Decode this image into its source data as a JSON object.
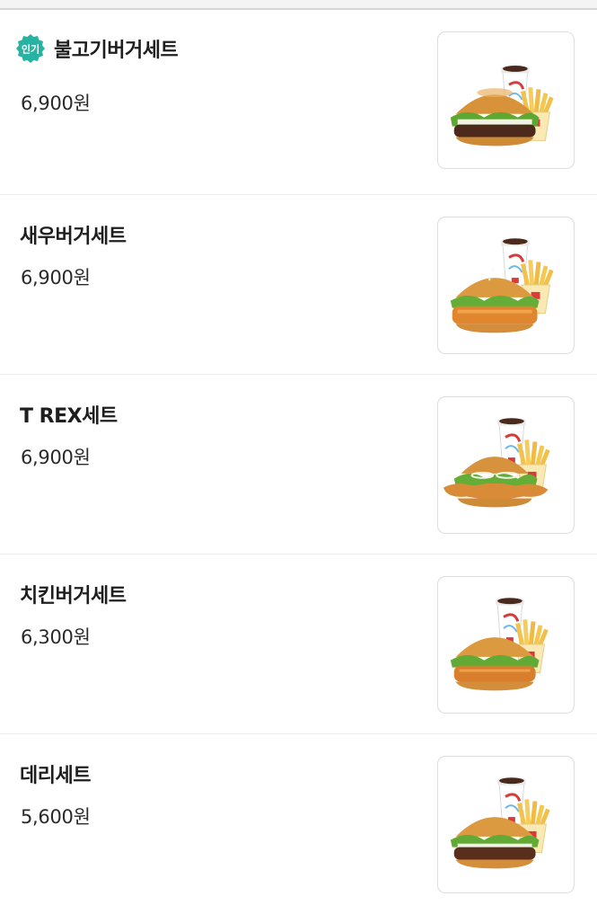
{
  "badge": {
    "label": "인기",
    "color": "#26b3a2",
    "icon": "popular-badge-icon"
  },
  "menu": [
    {
      "name": "불고기버거세트",
      "price": "6,900원",
      "popular": true,
      "image": "bulgogi-burger-set-image"
    },
    {
      "name": "새우버거세트",
      "price": "6,900원",
      "popular": false,
      "image": "shrimp-burger-set-image"
    },
    {
      "name": "T REX세트",
      "price": "6,900원",
      "popular": false,
      "image": "t-rex-set-image"
    },
    {
      "name": "치킨버거세트",
      "price": "6,300원",
      "popular": false,
      "image": "chicken-burger-set-image"
    },
    {
      "name": "데리세트",
      "price": "5,600원",
      "popular": false,
      "image": "teri-set-image"
    }
  ]
}
